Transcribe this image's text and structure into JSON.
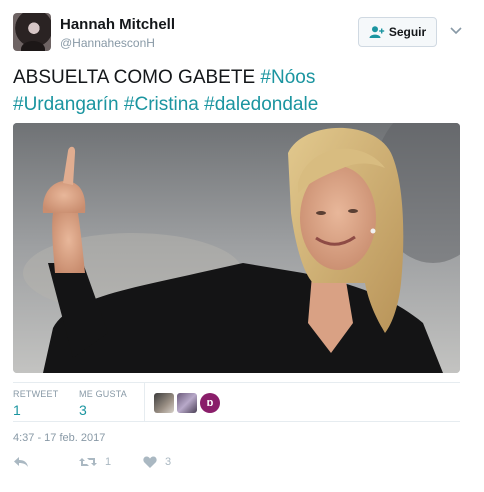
{
  "user": {
    "name": "Hannah Mitchell",
    "handle": "@HannahesconH"
  },
  "follow_button": {
    "label": "Seguir",
    "icon": "add-user-icon"
  },
  "tweet": {
    "text_plain": "ABSUELTA COMO GABETE",
    "hashtags": [
      "#Nóos",
      "#Urdangarín",
      "#Cristina",
      "#daledondale"
    ],
    "image_alt": "Photo of a woman in a black jacket raising her middle finger"
  },
  "stats": {
    "retweets_label": "RETWEET",
    "retweets_count": "1",
    "likes_label": "ME GUSTA",
    "likes_count": "3",
    "liker_badge": "ɒ"
  },
  "timestamp": "4:37 - 17 feb. 2017",
  "actions": {
    "reply_icon": "reply-icon",
    "retweet_icon": "retweet-icon",
    "retweet_count": "1",
    "like_icon": "heart-icon",
    "like_count": "3"
  },
  "colors": {
    "hashtag": "#1b95a0",
    "muted": "#8899a6"
  }
}
